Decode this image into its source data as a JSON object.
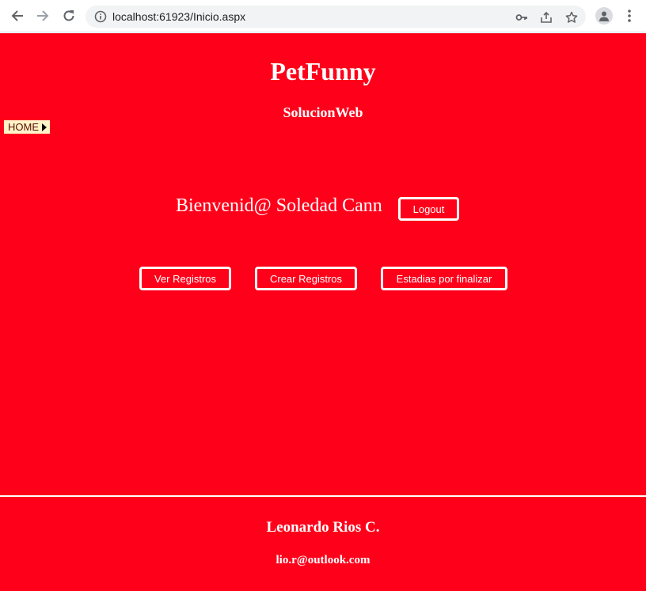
{
  "browser": {
    "url": "localhost:61923/Inicio.aspx",
    "icons": [
      "back-icon",
      "forward-icon",
      "reload-icon",
      "site-info-icon",
      "key-icon",
      "share-icon",
      "star-icon",
      "profile-icon",
      "menu-icon"
    ]
  },
  "header": {
    "title": "PetFunny",
    "subtitle": "SolucionWeb"
  },
  "menu": {
    "home_label": "HOME"
  },
  "main": {
    "welcome": "Bienvenid@ Soledad Cann",
    "logout_label": "Logout",
    "actions": [
      "Ver Registros",
      "Crear Registros",
      "Estadias por finalizar"
    ]
  },
  "footer": {
    "name": "Leonardo Rios C.",
    "email": "lio.r@outlook.com"
  },
  "colors": {
    "page_background": "#ff001a",
    "text": "#ffffff",
    "menu_background": "#fff4c9"
  }
}
